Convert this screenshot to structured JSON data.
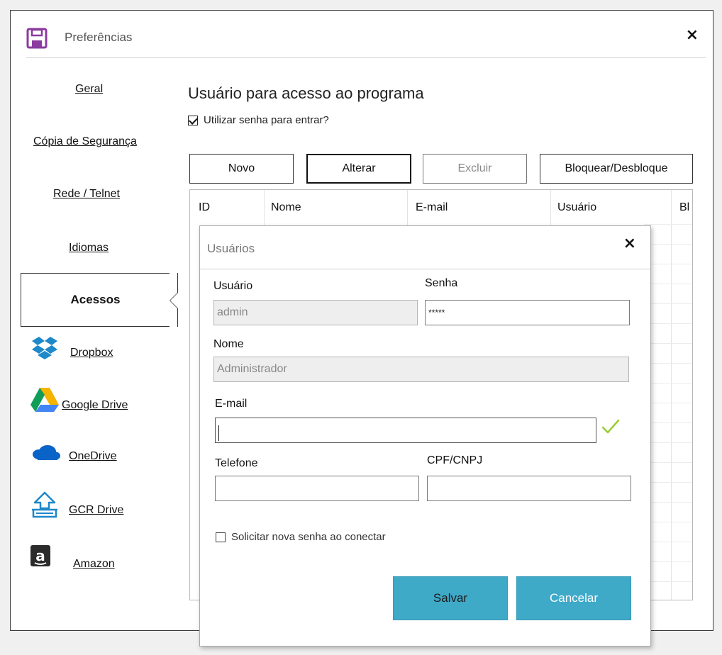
{
  "window": {
    "title": "Preferências",
    "close_label": "×"
  },
  "sidebar": {
    "items": [
      {
        "label": "Geral",
        "icon": null
      },
      {
        "label": "Cópia de Segurança",
        "icon": null
      },
      {
        "label": "Rede / Telnet",
        "icon": null
      },
      {
        "label": "Idiomas",
        "icon": null
      },
      {
        "label": "Acessos",
        "icon": null,
        "selected": true
      },
      {
        "label": "Dropbox",
        "icon": "dropbox-icon"
      },
      {
        "label": "Google Drive",
        "icon": "google-drive-icon"
      },
      {
        "label": "OneDrive",
        "icon": "onedrive-icon"
      },
      {
        "label": "GCR Drive",
        "icon": "gcr-drive-icon"
      },
      {
        "label": "Amazon",
        "icon": "amazon-icon"
      }
    ]
  },
  "main": {
    "title": "Usuário para acesso ao programa",
    "use_password": {
      "label": "Utilizar senha para entrar?",
      "checked": true
    },
    "buttons": {
      "new": "Novo",
      "edit": "Alterar",
      "delete": "Excluir",
      "block": "Bloquear/Desbloque"
    },
    "grid": {
      "columns": [
        "ID",
        "Nome",
        "E-mail",
        "Usuário",
        "Bl"
      ]
    }
  },
  "dialog": {
    "title": "Usuários",
    "close_label": "×",
    "username": {
      "label": "Usuário",
      "value": "admin"
    },
    "password": {
      "label": "Senha",
      "value": "*****"
    },
    "name": {
      "label": "Nome",
      "value": "Administrador"
    },
    "email": {
      "label": "E-mail",
      "value": ""
    },
    "phone": {
      "label": "Telefone",
      "value": ""
    },
    "cpf_cnpj": {
      "label": "CPF/CNPJ",
      "value": ""
    },
    "request_new_password": {
      "label": "Solicitar nova senha ao conectar",
      "checked": false
    },
    "save_label": "Salvar",
    "cancel_label": "Cancelar"
  },
  "colors": {
    "accent": "#3fa9c8",
    "check_ok": "#9acd32",
    "save_icon": "#8b3aa0"
  }
}
